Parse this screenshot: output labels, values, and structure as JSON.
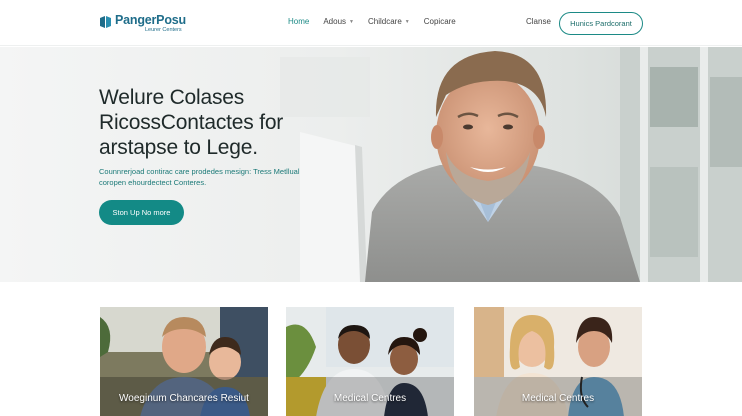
{
  "brand": {
    "name": "PangerPosu",
    "tagline": "Leurer Centers",
    "color": "#1f6d8a"
  },
  "nav": {
    "items": [
      {
        "label": "Home",
        "active": true,
        "dropdown": false
      },
      {
        "label": "Adous",
        "active": false,
        "dropdown": true
      },
      {
        "label": "Childcare",
        "active": false,
        "dropdown": true
      },
      {
        "label": "Copicare",
        "active": false,
        "dropdown": false
      }
    ],
    "login_label": "Clanse",
    "cta_label": "Hunics Pardcorant"
  },
  "hero": {
    "title_lines": [
      "Welure Colases",
      "RicossContactes for",
      "arstapse to Lege."
    ],
    "subtitle": "Counnrerjoad contirac care prodedes mesign: Tress Metllual coropen ehourdectect Conteres.",
    "button_label": "Ston Up No more"
  },
  "cards": [
    {
      "title": "Woeginum Chancares Resiut"
    },
    {
      "title": "Medical Centres"
    },
    {
      "title": "Medical Centres"
    }
  ],
  "colors": {
    "accent": "#138a86",
    "accent_text": "#1c7a78",
    "heading": "#1f2a2a"
  }
}
